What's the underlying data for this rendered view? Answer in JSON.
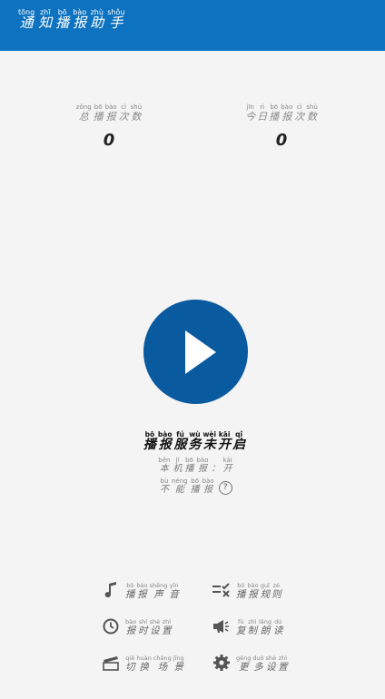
{
  "app": {
    "title": [
      {
        "py": "tōng",
        "hz": "通"
      },
      {
        "py": "zhī",
        "hz": "知"
      },
      {
        "py": "bō",
        "hz": "播"
      },
      {
        "py": "bào",
        "hz": "报"
      },
      {
        "py": "zhù",
        "hz": "助"
      },
      {
        "py": "shǒu",
        "hz": "手"
      }
    ]
  },
  "stats": {
    "total": {
      "label": [
        {
          "py": "zǒng",
          "hz": "总"
        },
        {
          "py": "bō",
          "hz": "播"
        },
        {
          "py": "bào",
          "hz": "报"
        },
        {
          "py": "cì",
          "hz": "次"
        },
        {
          "py": "shù",
          "hz": "数"
        }
      ],
      "value": "0"
    },
    "today": {
      "label": [
        {
          "py": "jīn",
          "hz": "今"
        },
        {
          "py": "rì",
          "hz": "日"
        },
        {
          "py": "bō",
          "hz": "播"
        },
        {
          "py": "bào",
          "hz": "报"
        },
        {
          "py": "cì",
          "hz": "次"
        },
        {
          "py": "shù",
          "hz": "数"
        }
      ],
      "value": "0"
    }
  },
  "status": [
    {
      "py": "bō",
      "hz": "播"
    },
    {
      "py": "bào",
      "hz": "报"
    },
    {
      "py": "fú",
      "hz": "服"
    },
    {
      "py": "wù",
      "hz": "务"
    },
    {
      "py": "wèi",
      "hz": "未"
    },
    {
      "py": "kāi",
      "hz": "开"
    },
    {
      "py": "qǐ",
      "hz": "启"
    }
  ],
  "local_broadcast": [
    {
      "py": "běn",
      "hz": "本"
    },
    {
      "py": "jī",
      "hz": "机"
    },
    {
      "py": "bō",
      "hz": "播"
    },
    {
      "py": "bào",
      "hz": "报"
    },
    {
      "py": "",
      "hz": "："
    },
    {
      "py": "kāi",
      "hz": "开"
    }
  ],
  "cannot_broadcast": [
    {
      "py": "bù",
      "hz": "不"
    },
    {
      "py": "néng",
      "hz": "能"
    },
    {
      "py": "bō",
      "hz": "播"
    },
    {
      "py": "bào",
      "hz": "报"
    }
  ],
  "help_glyph": "?",
  "menu": {
    "voice": [
      {
        "py": "bō",
        "hz": "播"
      },
      {
        "py": "bào",
        "hz": "报"
      },
      {
        "py": "shēng",
        "hz": "声"
      },
      {
        "py": "yīn",
        "hz": "音"
      }
    ],
    "rules": [
      {
        "py": "bō",
        "hz": "播"
      },
      {
        "py": "bào",
        "hz": "报"
      },
      {
        "py": "guī",
        "hz": "规"
      },
      {
        "py": "zé",
        "hz": "则"
      }
    ],
    "time": [
      {
        "py": "bào",
        "hz": "报"
      },
      {
        "py": "shí",
        "hz": "时"
      },
      {
        "py": "shè",
        "hz": "设"
      },
      {
        "py": "zhì",
        "hz": "置"
      }
    ],
    "reread": [
      {
        "py": "fù",
        "hz": "复"
      },
      {
        "py": "zhì",
        "hz": "制"
      },
      {
        "py": "lǎng",
        "hz": "朗"
      },
      {
        "py": "dú",
        "hz": "读"
      }
    ],
    "scene": [
      {
        "py": "qiē",
        "hz": "切"
      },
      {
        "py": "huàn",
        "hz": "换"
      },
      {
        "py": "chǎng",
        "hz": "场"
      },
      {
        "py": "jǐng",
        "hz": "景"
      }
    ],
    "more": [
      {
        "py": "gēng",
        "hz": "更"
      },
      {
        "py": "duō",
        "hz": "多"
      },
      {
        "py": "shè",
        "hz": "设"
      },
      {
        "py": "zhì",
        "hz": "置"
      }
    ]
  },
  "icons": {
    "voice": "music-note-icon",
    "rules": "rule-list-icon",
    "time": "clock-icon",
    "reread": "megaphone-icon",
    "scene": "clapperboard-icon",
    "more": "gear-icon",
    "play": "play-icon"
  },
  "colors": {
    "appbar": "#0d72bf",
    "play_button": "#0a5aa0",
    "background": "#f4f4f4"
  }
}
